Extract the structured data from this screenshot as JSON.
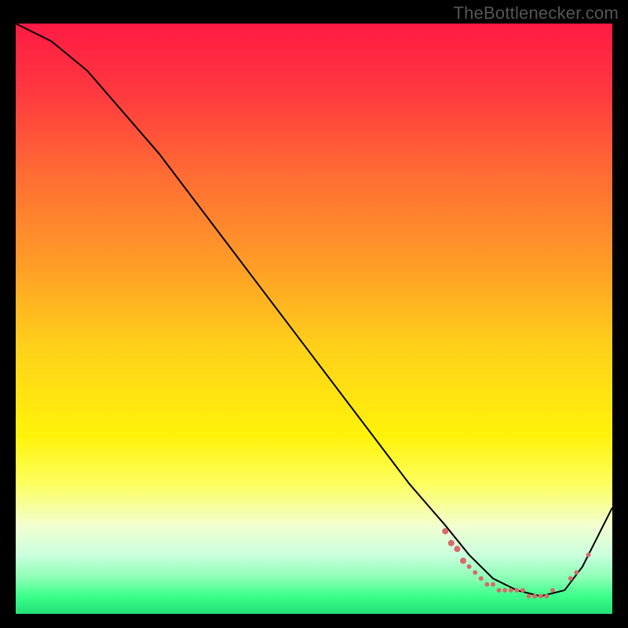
{
  "attribution": "TheBottlenecker.com",
  "colors": {
    "frame": "#000000",
    "curve_stroke": "#000000",
    "marker_fill": "#d86a6a",
    "marker_stroke": "#d86a6a"
  },
  "chart_data": {
    "type": "line",
    "title": "",
    "xlabel": "",
    "ylabel": "",
    "xlim": [
      0,
      100
    ],
    "ylim": [
      0,
      100
    ],
    "gradient_stops": [
      {
        "pct": 0,
        "color": "#ff1a44"
      },
      {
        "pct": 12,
        "color": "#ff3a3f"
      },
      {
        "pct": 25,
        "color": "#ff6a34"
      },
      {
        "pct": 40,
        "color": "#ff9a28"
      },
      {
        "pct": 55,
        "color": "#ffd11a"
      },
      {
        "pct": 70,
        "color": "#fff30a"
      },
      {
        "pct": 78,
        "color": "#fdff60"
      },
      {
        "pct": 85,
        "color": "#f3ffd0"
      },
      {
        "pct": 90,
        "color": "#caffde"
      },
      {
        "pct": 94,
        "color": "#8affb4"
      },
      {
        "pct": 97,
        "color": "#3bff8a"
      },
      {
        "pct": 100,
        "color": "#22e077"
      }
    ],
    "series": [
      {
        "name": "bottleneck-curve",
        "x": [
          0,
          6,
          12,
          18,
          24,
          30,
          36,
          42,
          48,
          54,
          60,
          66,
          72,
          76,
          80,
          84,
          88,
          92,
          95,
          100
        ],
        "y": [
          100,
          97,
          92,
          85,
          78,
          70,
          62,
          54,
          46,
          38,
          30,
          22,
          15,
          10,
          6,
          4,
          3,
          4,
          8,
          18
        ]
      }
    ],
    "markers": {
      "name": "highlight-cluster",
      "points": [
        {
          "x": 72,
          "y": 14,
          "r": 4
        },
        {
          "x": 73,
          "y": 12,
          "r": 4
        },
        {
          "x": 74,
          "y": 11,
          "r": 4
        },
        {
          "x": 75,
          "y": 9,
          "r": 4
        },
        {
          "x": 76,
          "y": 8,
          "r": 3
        },
        {
          "x": 77,
          "y": 7,
          "r": 3
        },
        {
          "x": 78,
          "y": 6,
          "r": 3
        },
        {
          "x": 79,
          "y": 5,
          "r": 3
        },
        {
          "x": 80,
          "y": 5,
          "r": 3
        },
        {
          "x": 81,
          "y": 4,
          "r": 3
        },
        {
          "x": 82,
          "y": 4,
          "r": 3
        },
        {
          "x": 83,
          "y": 4,
          "r": 3
        },
        {
          "x": 84,
          "y": 4,
          "r": 3
        },
        {
          "x": 85,
          "y": 4,
          "r": 3
        },
        {
          "x": 86,
          "y": 3,
          "r": 3
        },
        {
          "x": 87,
          "y": 3,
          "r": 3
        },
        {
          "x": 88,
          "y": 3,
          "r": 3
        },
        {
          "x": 89,
          "y": 3,
          "r": 3
        },
        {
          "x": 90,
          "y": 4,
          "r": 3
        },
        {
          "x": 93,
          "y": 6,
          "r": 3
        },
        {
          "x": 94,
          "y": 7,
          "r": 3
        },
        {
          "x": 96,
          "y": 10,
          "r": 3
        }
      ]
    }
  }
}
